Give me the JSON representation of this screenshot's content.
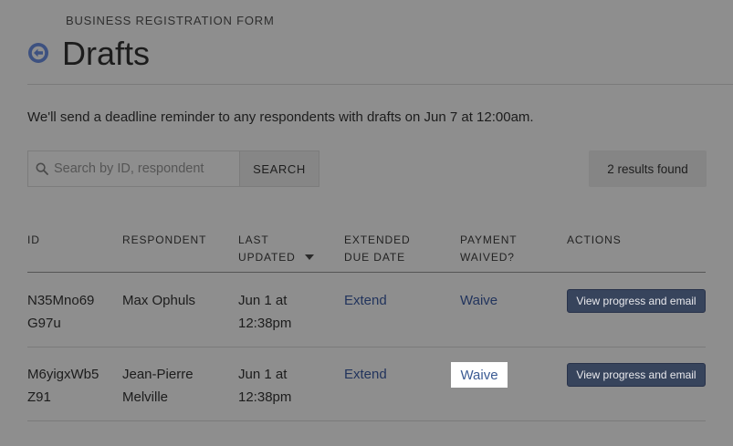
{
  "header": {
    "kicker": "BUSINESS REGISTRATION FORM",
    "title": "Drafts",
    "back_icon": "arrow-left-circle-icon"
  },
  "notice": "We'll send a deadline reminder to any respondents with drafts on Jun 7 at 12:00am.",
  "search": {
    "placeholder": "Search by ID, respondent",
    "value": "",
    "button_label": "SEARCH",
    "icon": "search-icon"
  },
  "results_count": "2 results found",
  "table": {
    "columns": [
      {
        "line1": "ID",
        "line2": ""
      },
      {
        "line1": "RESPONDENT",
        "line2": ""
      },
      {
        "line1": "LAST",
        "line2": "UPDATED",
        "sort": "descending"
      },
      {
        "line1": "EXTENDED",
        "line2": "DUE DATE"
      },
      {
        "line1": "PAYMENT",
        "line2": "WAIVED?"
      },
      {
        "line1": "ACTIONS",
        "line2": ""
      }
    ],
    "rows": [
      {
        "id": "N35Mno69G97u",
        "respondent": "Max Ophuls",
        "last_updated_date": "Jun 1 at",
        "last_updated_time": "12:38pm",
        "extend_label": "Extend",
        "waive_label": "Waive",
        "action_label": "View progress and email"
      },
      {
        "id": "M6yigxWb5Z91",
        "respondent": "Jean-Pierre Melville",
        "last_updated_date": "Jun 1 at",
        "last_updated_time": "12:38pm",
        "extend_label": "Extend",
        "waive_label": "Waive",
        "action_label": "View progress and email"
      }
    ]
  },
  "colors": {
    "overlay_background": "#8e8e8e",
    "link": "#22345d",
    "button": "#37445c",
    "highlight": "#ffffff"
  }
}
